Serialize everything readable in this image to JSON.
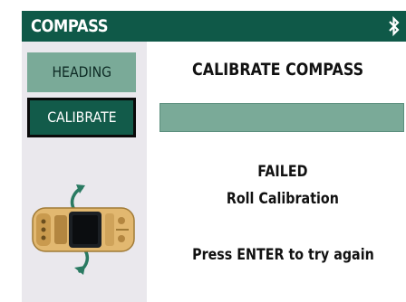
{
  "header": {
    "title": "COMPASS",
    "status_icon": "bluetooth-icon"
  },
  "sidebar": {
    "buttons": [
      {
        "label": "HEADING",
        "selected": false
      },
      {
        "label": "CALIBRATE",
        "selected": true
      }
    ],
    "illustration": "gps-device-rotate-icon"
  },
  "main": {
    "title": "CALIBRATE COMPASS",
    "progress": 1.0,
    "status_line1": "FAILED",
    "status_line2": "Roll Calibration",
    "instruction": "Press ENTER to try again"
  },
  "colors": {
    "header_bg": "#0f5948",
    "accent_light": "#7aaa98",
    "accent_dark": "#125b4a",
    "sidebar_bg": "#eae8ed",
    "device_body": "#e2b870"
  }
}
